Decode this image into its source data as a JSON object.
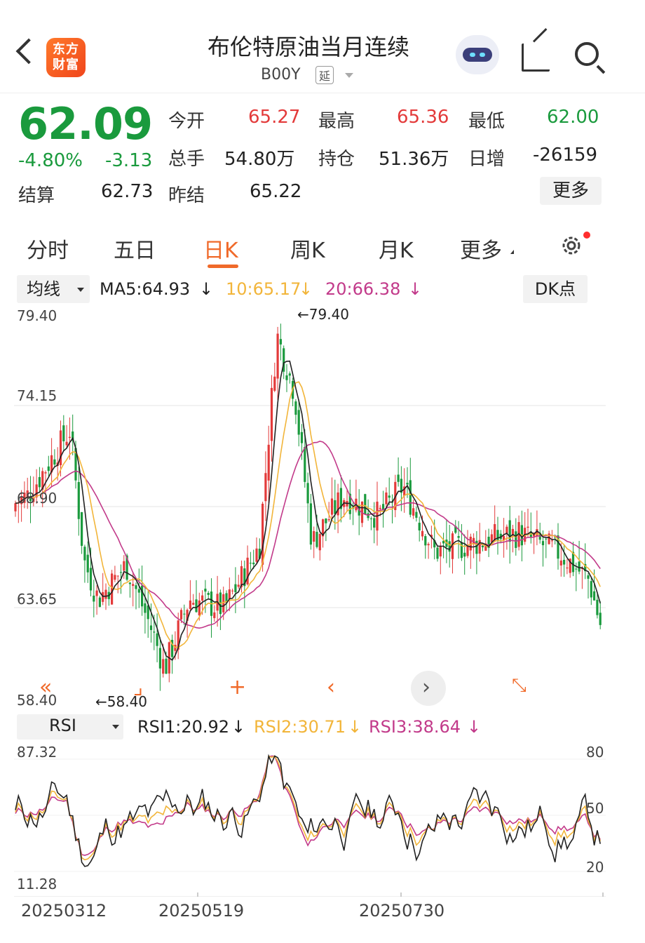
{
  "header": {
    "logo_text": "东方财富",
    "title": "布伦特原油当月连续",
    "code": "B00Y",
    "tag": "延",
    "icons": [
      "back-icon",
      "assistant-robot-icon",
      "share-icon",
      "search-icon"
    ]
  },
  "quote": {
    "price": "62.09",
    "change_pct": "-4.80%",
    "change": "-3.13",
    "open_label": "今开",
    "open": "65.27",
    "high_label": "最高",
    "high": "65.36",
    "low_label": "最低",
    "low": "62.00",
    "volume_label": "总手",
    "volume": "54.80万",
    "oi_label": "持仓",
    "oi": "51.36万",
    "daily_inc_label": "日增",
    "daily_inc": "-26159",
    "settle_label": "结算",
    "settle": "62.73",
    "prev_settle_label": "昨结",
    "prev_settle": "65.22",
    "more": "更多"
  },
  "tabs": [
    {
      "label": "分时"
    },
    {
      "label": "五日"
    },
    {
      "label": "日K",
      "active": true
    },
    {
      "label": "周K"
    },
    {
      "label": "月K"
    },
    {
      "label": "更多"
    }
  ],
  "ma_bar": {
    "select": "均线",
    "ma5": "MA5:64.93",
    "ma10": "10:65.17",
    "ma20": "20:66.38",
    "dk": "DK点"
  },
  "colors": {
    "up": "#e33a3a",
    "down": "#1a9a3d",
    "ma5": "#222222",
    "ma10": "#f2b53a",
    "ma20": "#c23a8a",
    "accent": "#f06a2a"
  },
  "kline": {
    "y_labels": [
      "79.40",
      "74.15",
      "68.90",
      "63.65",
      "58.40"
    ],
    "max_label": "←79.40",
    "min_label": "←58.40",
    "ylim": [
      58.4,
      79.4
    ]
  },
  "controls": [
    "double-left-icon",
    "bracket-icon",
    "plus-icon",
    "chevron-left-icon",
    "chevron-right-icon",
    "expand-icon"
  ],
  "rsi_bar": {
    "select": "RSI",
    "rsi1": "RSI1:20.92",
    "rsi2": "RSI2:30.71",
    "rsi3": "RSI3:38.64"
  },
  "rsi": {
    "left_labels": [
      "87.32",
      "11.28"
    ],
    "right_labels": [
      "80",
      "50",
      "20"
    ]
  },
  "dates": [
    "20250312",
    "20250519",
    "20250730"
  ]
}
